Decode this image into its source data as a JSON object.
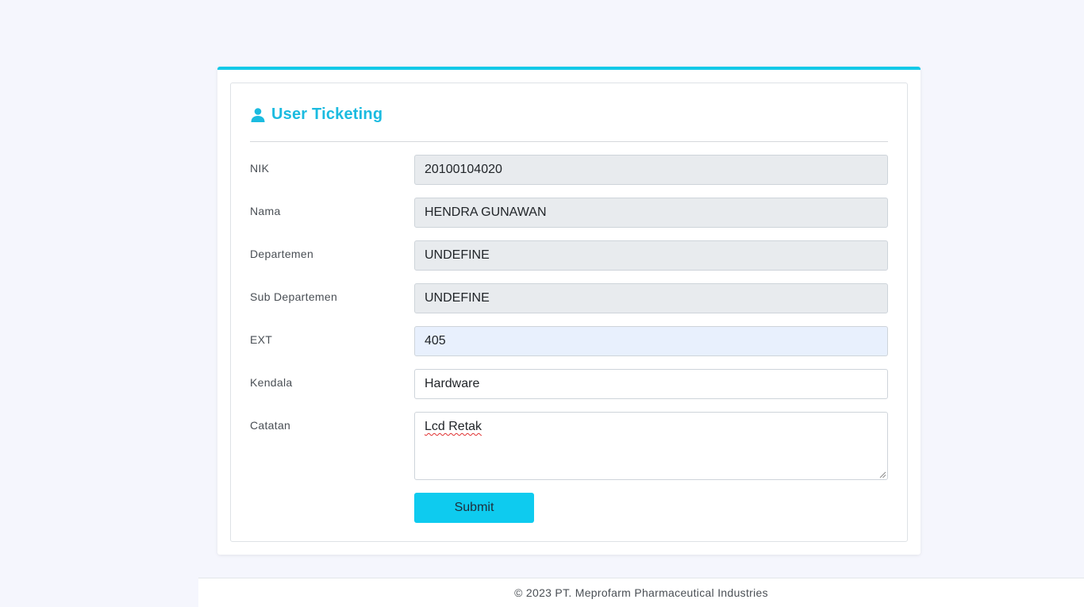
{
  "form": {
    "title": "User Ticketing",
    "title_icon": "user-icon",
    "accent_color": "#13c9e8",
    "fields": {
      "nik": {
        "label": "NIK",
        "value": "20100104020"
      },
      "nama": {
        "label": "Nama",
        "value": "HENDRA GUNAWAN"
      },
      "departemen": {
        "label": "Departemen",
        "value": "UNDEFINE"
      },
      "sub_departemen": {
        "label": "Sub Departemen",
        "value": "UNDEFINE"
      },
      "ext": {
        "label": "EXT",
        "value": "405"
      },
      "kendala": {
        "label": "Kendala",
        "value": "Hardware"
      },
      "catatan": {
        "label": "Catatan",
        "value": "Lcd Retak"
      }
    },
    "submit_label": "Submit"
  },
  "footer": {
    "text": "© 2023 PT. Meprofarm Pharmaceutical Industries"
  }
}
